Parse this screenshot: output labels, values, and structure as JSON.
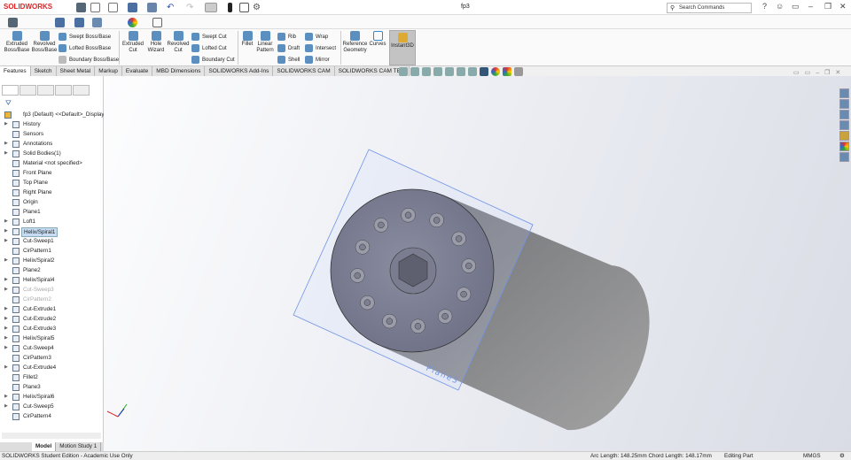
{
  "app": {
    "logo": "SOLIDWORKS",
    "title": "fp3",
    "search_placeholder": "Search Commands"
  },
  "ribbon": {
    "extruded_boss": "Extruded Boss/Base",
    "revolved_boss": "Revolved Boss/Base",
    "swept_boss": "Swept Boss/Base",
    "lofted_boss": "Lofted Boss/Base",
    "boundary_boss": "Boundary Boss/Base",
    "extruded_cut": "Extruded Cut",
    "hole_wizard": "Hole Wizard",
    "revolved_cut": "Revolved Cut",
    "swept_cut": "Swept Cut",
    "lofted_cut": "Lofted Cut",
    "boundary_cut": "Boundary Cut",
    "fillet": "Fillet",
    "linear_pattern": "Linear Pattern",
    "rib": "Rib",
    "draft": "Draft",
    "shell": "Shell",
    "wrap": "Wrap",
    "intersect": "Intersect",
    "mirror": "Mirror",
    "reference_geometry": "Reference Geometry",
    "curves": "Curves",
    "instant3d": "Instant3D"
  },
  "tabs": [
    "Features",
    "Sketch",
    "Sheet Metal",
    "Markup",
    "Evaluate",
    "MBD Dimensions",
    "SOLIDWORKS Add-Ins",
    "SOLIDWORKS CAM",
    "SOLIDWORKS CAM TBM"
  ],
  "tree": {
    "root": "fp3 (Default) <<Default>_Display",
    "items": [
      {
        "label": "History",
        "exp": true
      },
      {
        "label": "Sensors"
      },
      {
        "label": "Annotations",
        "exp": true
      },
      {
        "label": "Solid Bodies(1)",
        "exp": true
      },
      {
        "label": "Material <not specified>"
      },
      {
        "label": "Front Plane"
      },
      {
        "label": "Top Plane"
      },
      {
        "label": "Right Plane"
      },
      {
        "label": "Origin"
      },
      {
        "label": "Plane1"
      },
      {
        "label": "Loft1",
        "exp": true
      },
      {
        "label": "Helix/Spiral1",
        "exp": true,
        "selected": true
      },
      {
        "label": "Cut-Sweep1",
        "exp": true
      },
      {
        "label": "CirPattern1"
      },
      {
        "label": "Helix/Spiral2",
        "exp": true
      },
      {
        "label": "Plane2"
      },
      {
        "label": "Helix/Spiral4",
        "exp": true
      },
      {
        "label": "Cut-Sweep3",
        "exp": true,
        "suppressed": true
      },
      {
        "label": "CirPattern2",
        "suppressed": true
      },
      {
        "label": "Cut-Extrude1",
        "exp": true
      },
      {
        "label": "Cut-Extrude2",
        "exp": true
      },
      {
        "label": "Cut-Extrude3",
        "exp": true
      },
      {
        "label": "Helix/Spiral5",
        "exp": true
      },
      {
        "label": "Cut-Sweep4",
        "exp": true
      },
      {
        "label": "CirPattern3"
      },
      {
        "label": "Cut-Extrude4",
        "exp": true
      },
      {
        "label": "Fillet2"
      },
      {
        "label": "Plane3"
      },
      {
        "label": "Helix/Spiral6",
        "exp": true
      },
      {
        "label": "Cut-Sweep5",
        "exp": true
      },
      {
        "label": "CirPattern4"
      }
    ]
  },
  "bottom_tabs": [
    "Model",
    "Motion Study 1"
  ],
  "viewport": {
    "plane_label": "Plane3"
  },
  "status": {
    "edition": "SOLIDWORKS Student Edition - Academic Use Only",
    "measure": "Arc Length: 148.25mm Chord Length: 148.17mm",
    "mode": "Editing Part",
    "units": "MMGS"
  }
}
